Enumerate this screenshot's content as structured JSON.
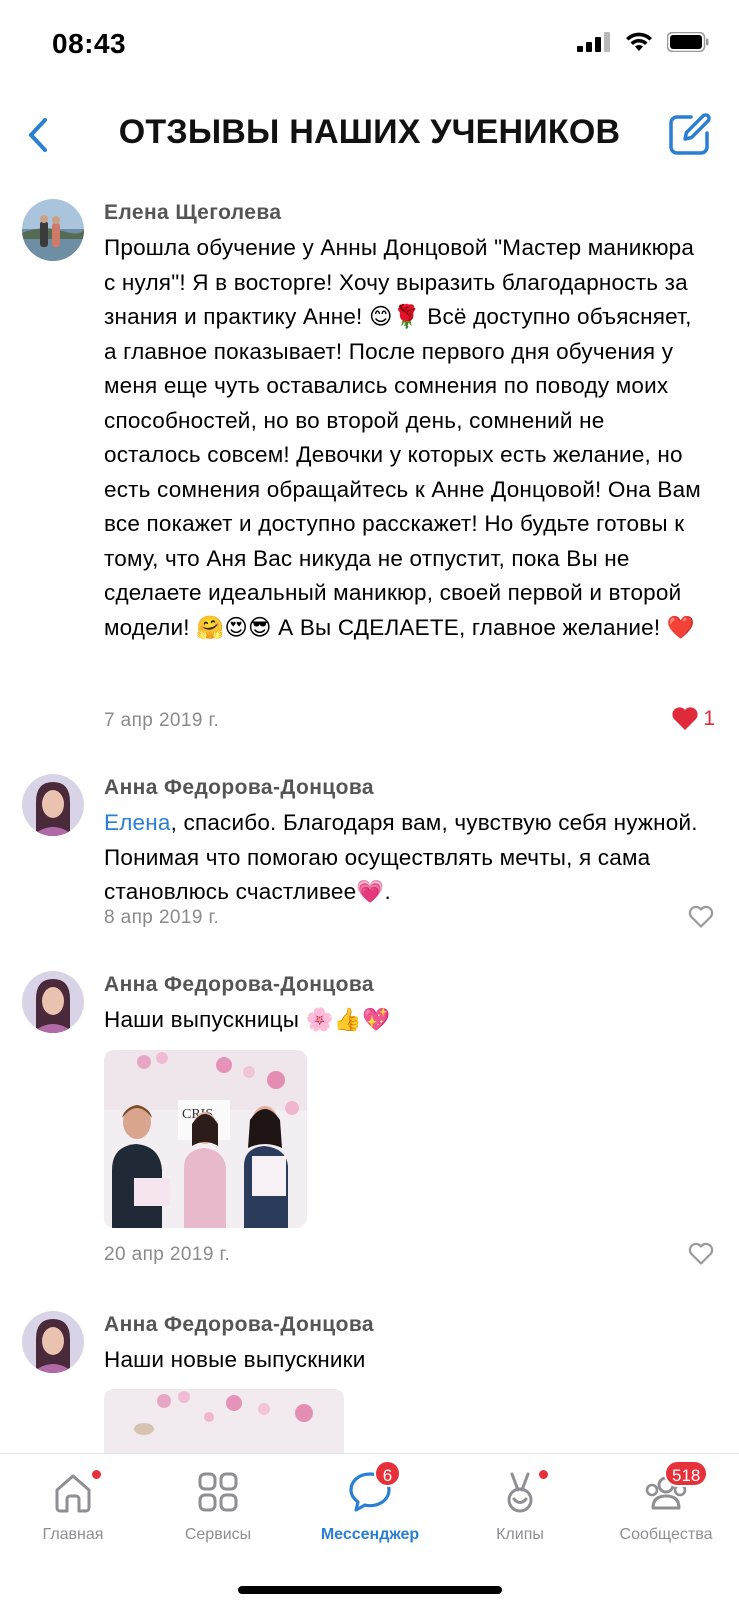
{
  "status": {
    "time": "08:43"
  },
  "header": {
    "title": "ОТЗЫВЫ НАШИХ УЧЕНИКОВ",
    "back_icon": "chevron-left-icon",
    "edit_icon": "compose-icon"
  },
  "accent_color": "#2a7fd4",
  "comments": [
    {
      "author": "Елена Щеголева",
      "text": "Прошла обучение у Анны Донцовой \"Мастер маникюра с нуля\"! Я в восторге! Хочу выразить благодарность за знания и практику Анне! 😊🌹 Всё доступно объясняет, а главное показывает! После первого дня обучения у меня еще чуть оставались сомнения по поводу моих способностей, но во второй день, сомнений не осталось совсем! Девочки у которых есть желание, но есть сомнения обращайтесь к Анне Донцовой! Она Вам все покажет и доступно расскажет! Но будьте готовы к тому, что Аня Вас никуда не отпустит, пока Вы не сделаете идеальный маникюр, своей первой и второй модели! 🤗😍😎 А Вы СДЕЛАЕТЕ, главное желание! ❤️",
      "date": "7 апр 2019 г.",
      "likes": "1",
      "liked": true
    },
    {
      "author": "Анна Федорова-Донцова",
      "mention": "Елена",
      "text": ", спасибо. Благодаря вам, чувствую себя нужной. Понимая что помогаю осуществлять мечты, я сама становлюсь счастливее💗.",
      "date": "8 апр 2019 г.",
      "liked": false
    },
    {
      "author": "Анна Федорова-Донцова",
      "text": "Наши выпускницы 🌸👍💖",
      "date": "20 апр 2019 г.",
      "liked": false,
      "photo_sign": "CRIS"
    },
    {
      "author": "Анна Федорова-Донцова",
      "text": "Наши новые выпускники"
    }
  ],
  "tabbar": [
    {
      "label": "Главная",
      "icon": "home-icon",
      "dot": true
    },
    {
      "label": "Сервисы",
      "icon": "services-grid-icon"
    },
    {
      "label": "Мессенджер",
      "icon": "messenger-icon",
      "badge": "6",
      "active": true
    },
    {
      "label": "Клипы",
      "icon": "clips-icon",
      "dot": true
    },
    {
      "label": "Сообщества",
      "icon": "communities-icon",
      "badge": "518"
    }
  ]
}
